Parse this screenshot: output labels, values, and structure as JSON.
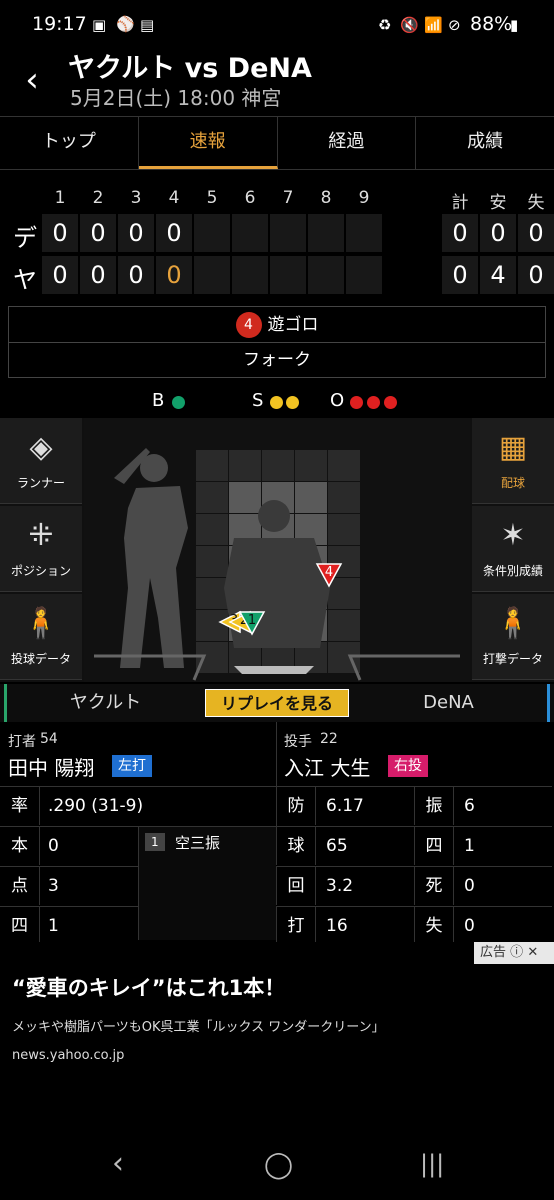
{
  "status": {
    "time": "19:17",
    "battery": "88%"
  },
  "header": {
    "title": "ヤクルト vs DeNA",
    "subtitle": "5月2日(土) 18:00 神宮"
  },
  "tabs": [
    "トップ",
    "速報",
    "経過",
    "成績"
  ],
  "scoreboard": {
    "innings": [
      "1",
      "2",
      "3",
      "4",
      "5",
      "6",
      "7",
      "8",
      "9"
    ],
    "totals_headers": [
      "計",
      "安",
      "失"
    ],
    "rows": [
      {
        "team": "デ",
        "scores": [
          "0",
          "0",
          "0",
          "0",
          "",
          "",
          "",
          "",
          ""
        ],
        "totals": [
          "0",
          "0",
          "0"
        ]
      },
      {
        "team": "ヤ",
        "scores": [
          "0",
          "0",
          "0",
          "0",
          "",
          "",
          "",
          "",
          ""
        ],
        "totals": [
          "0",
          "4",
          "0"
        ]
      }
    ]
  },
  "play": {
    "number": "4",
    "result": "遊ゴロ",
    "pitch": "フォーク"
  },
  "count": {
    "b_label": "B",
    "s_label": "S",
    "o_label": "O",
    "balls": 1,
    "strikes": 2,
    "outs": 3
  },
  "colors": {
    "ball": "#12a06a",
    "strike": "#f2c322",
    "out": "#e02020",
    "accent": "#e6a23c"
  },
  "side_left": [
    {
      "label": "ランナー",
      "icon": "diamond-icon"
    },
    {
      "label": "ポジション",
      "icon": "fielders-icon"
    },
    {
      "label": "投球データ",
      "icon": "pitcher-icon"
    }
  ],
  "side_right": [
    {
      "label": "配球",
      "icon": "pitch-grid-icon"
    },
    {
      "label": "条件別成績",
      "icon": "radar-icon"
    },
    {
      "label": "打撃データ",
      "icon": "batter-icon"
    }
  ],
  "pitches": [
    {
      "n": "4"
    },
    {
      "n": "3"
    },
    {
      "n": "2"
    },
    {
      "n": "1"
    }
  ],
  "teams": {
    "left": "ヤクルト",
    "replay": "リプレイを見る",
    "right": "DeNA"
  },
  "batter": {
    "label": "打者",
    "number": "54",
    "name": "田中 陽翔",
    "hand": "左打",
    "stats": [
      {
        "k": "率",
        "v": ".290 (31-9)"
      },
      {
        "k": "本",
        "v": "0"
      },
      {
        "k": "点",
        "v": "3"
      },
      {
        "k": "四",
        "v": "1"
      }
    ],
    "history": [
      {
        "n": "1",
        "result": "空三振"
      }
    ]
  },
  "pitcher": {
    "label": "投手",
    "number": "22",
    "name": "入江 大生",
    "hand": "右投",
    "stats": [
      {
        "k": "防",
        "v": "6.17"
      },
      {
        "k": "振",
        "v": "6"
      },
      {
        "k": "球",
        "v": "65"
      },
      {
        "k": "四",
        "v": "1"
      },
      {
        "k": "回",
        "v": "3.2"
      },
      {
        "k": "死",
        "v": "0"
      },
      {
        "k": "打",
        "v": "16"
      },
      {
        "k": "失",
        "v": "0"
      }
    ]
  },
  "ad": {
    "tag": "広告",
    "title": "“愛車のキレイ”はこれ1本！",
    "desc": "メッキや樹脂パーツもOK呉工業「ルックス ワンダークリーン」",
    "url": "news.yahoo.co.jp"
  }
}
